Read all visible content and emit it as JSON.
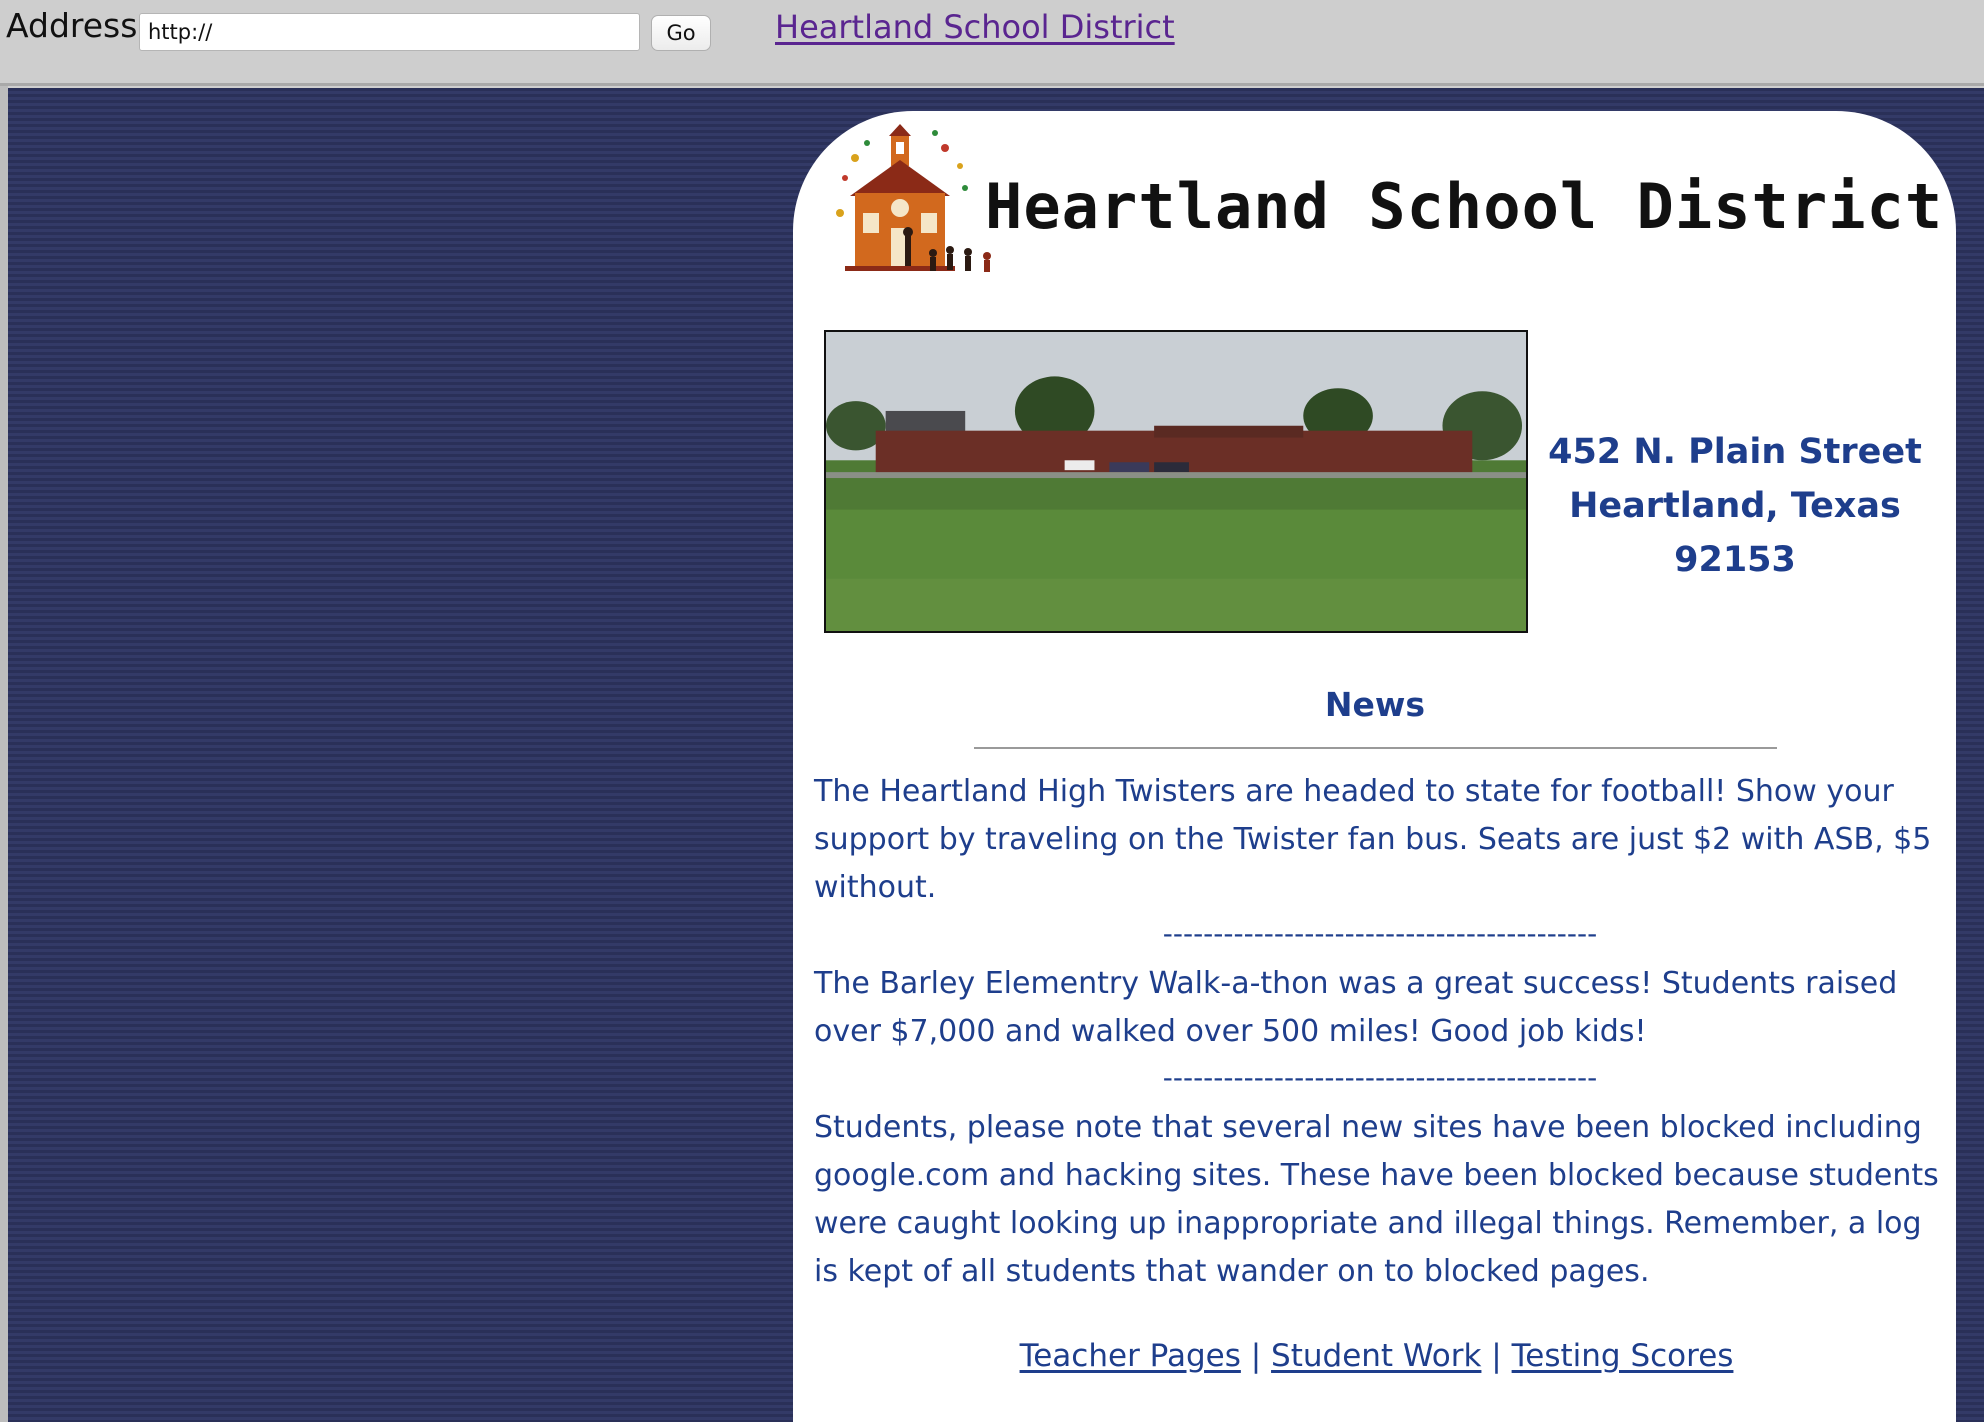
{
  "address_bar": {
    "label": "Address:",
    "url_value": "http://",
    "go_label": "Go",
    "site_link": "Heartland School District"
  },
  "header": {
    "title": "Heartland School District",
    "logo_icon": "schoolhouse-logo-icon"
  },
  "address": {
    "street": "452 N. Plain Street",
    "city": "Heartland, Texas",
    "zip": "92153"
  },
  "news": {
    "heading": "News",
    "separator": "-------------------------------------------",
    "items": [
      "The Heartland High Twisters are headed to state for football! Show your support by traveling on the Twister fan bus. Seats are just $2 with ASB, $5 without.",
      "The Barley Elementry Walk-a-thon was a great success! Students raised over $7,000 and walked over 500 miles! Good job kids!",
      "Students, please note that several new sites have been blocked including google.com and hacking sites. These have been blocked because students were caught looking up inappropriate and illegal things. Remember, a log is kept of all students that wander on to blocked pages."
    ]
  },
  "footer": {
    "links": [
      "Teacher Pages",
      "Student Work",
      "Testing Scores"
    ],
    "divider": "|"
  },
  "colors": {
    "text_blue": "#1e3e8c",
    "background_navy": "#2a3058",
    "visited_link": "#5a2590"
  }
}
